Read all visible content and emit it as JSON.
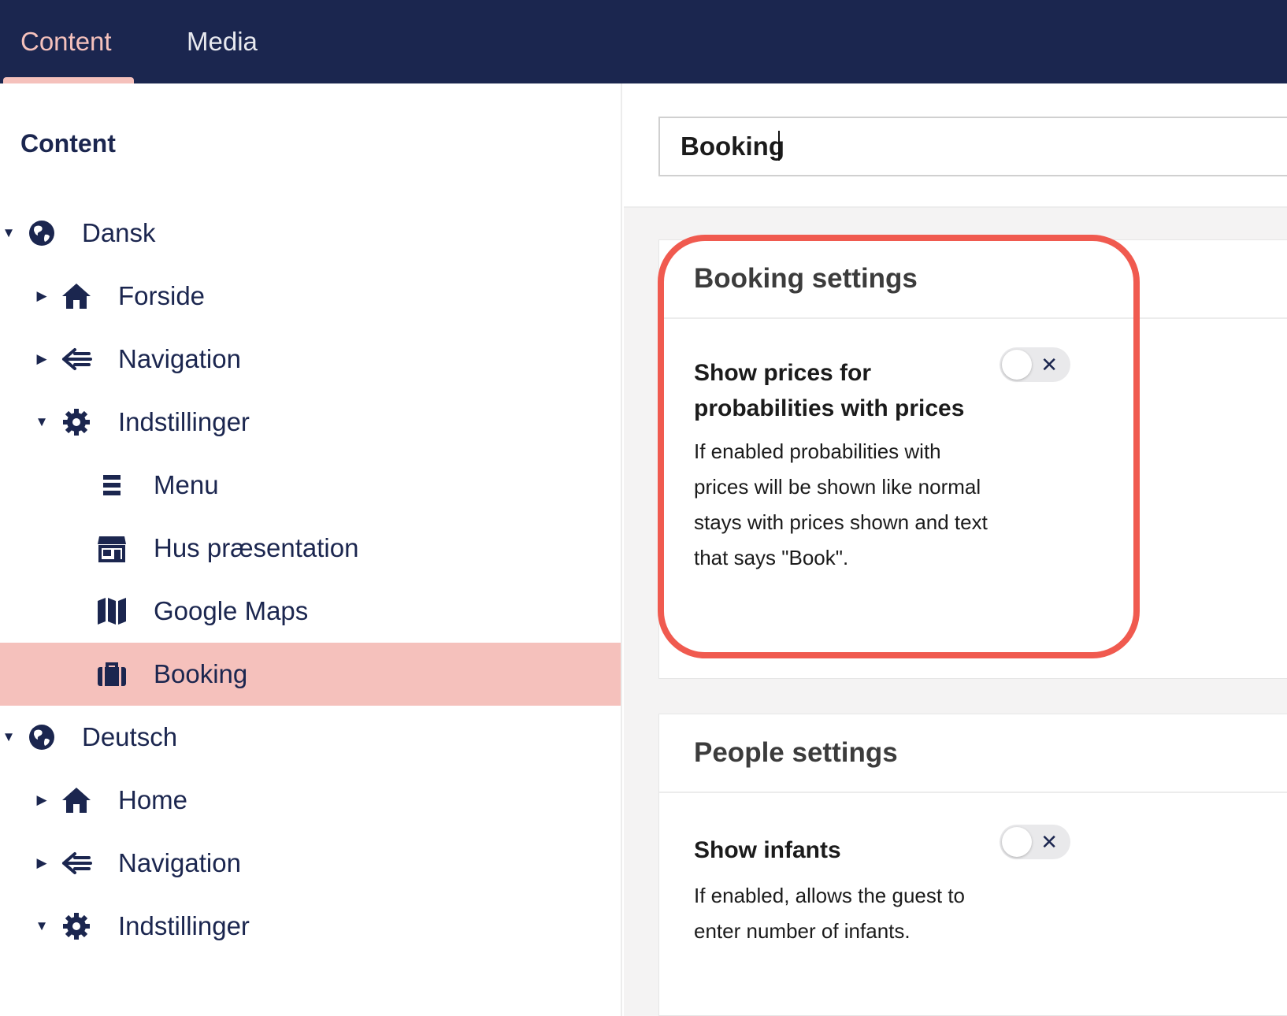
{
  "topbar": {
    "tabs": [
      {
        "label": "Content",
        "active": true
      },
      {
        "label": "Media",
        "active": false
      }
    ],
    "accent_color": "#f5c1bc",
    "background_color": "#1b264f"
  },
  "sidebar": {
    "title": "Content",
    "tree": [
      {
        "label": "Dansk",
        "icon": "globe-icon",
        "caret": "expanded"
      },
      {
        "label": "Forside",
        "icon": "home-icon",
        "caret": "collapsed"
      },
      {
        "label": "Navigation",
        "icon": "navigation-icon",
        "caret": "collapsed"
      },
      {
        "label": "Indstillinger",
        "icon": "gear-icon",
        "caret": "expanded"
      },
      {
        "label": "Menu",
        "icon": "list-icon",
        "caret": "none"
      },
      {
        "label": "Hus præsentation",
        "icon": "store-icon",
        "caret": "none"
      },
      {
        "label": "Google Maps",
        "icon": "map-icon",
        "caret": "none"
      },
      {
        "label": "Booking",
        "icon": "briefcase-icon",
        "caret": "none",
        "selected": true
      },
      {
        "label": "Deutsch",
        "icon": "globe-icon",
        "caret": "expanded"
      },
      {
        "label": "Home",
        "icon": "home-icon",
        "caret": "collapsed"
      },
      {
        "label": "Navigation",
        "icon": "navigation-icon",
        "caret": "collapsed"
      },
      {
        "label": "Indstillinger",
        "icon": "gear-icon",
        "caret": "expanded"
      }
    ]
  },
  "editor": {
    "name_value": "Booking",
    "panels": {
      "booking": {
        "title": "Booking settings",
        "field_label": "Show prices for probabilities with prices",
        "field_desc": "If enabled probabilities with prices will be shown like normal stays with prices shown and text that says \"Book\".",
        "toggle_on": false,
        "toggle_symbol": "✕"
      },
      "people": {
        "title": "People settings",
        "field_label": "Show infants",
        "field_desc": "If enabled, allows the guest to enter number of infants.",
        "toggle_on": false,
        "toggle_symbol": "✕"
      }
    }
  },
  "annotation": {
    "highlight_color": "#f05a4f"
  }
}
